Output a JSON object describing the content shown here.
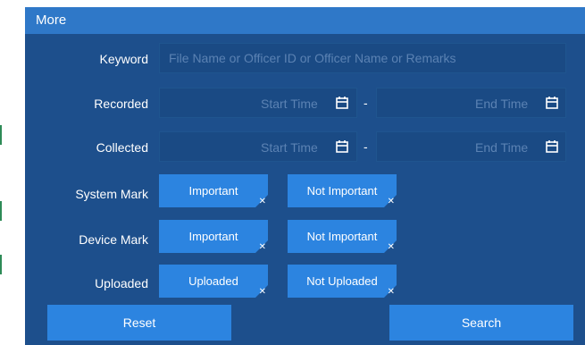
{
  "dialog": {
    "title": "More"
  },
  "keyword": {
    "label": "Keyword",
    "placeholder": "File Name or Officer ID or Officer Name or Remarks"
  },
  "recorded": {
    "label": "Recorded",
    "start_placeholder": "Start Time",
    "end_placeholder": "End Time",
    "separator": "-"
  },
  "collected": {
    "label": "Collected",
    "start_placeholder": "Start Time",
    "end_placeholder": "End Time",
    "separator": "-"
  },
  "system_mark": {
    "label": "System Mark",
    "options": [
      "Important",
      "Not Important"
    ]
  },
  "device_mark": {
    "label": "Device Mark",
    "options": [
      "Important",
      "Not Important"
    ]
  },
  "uploaded": {
    "label": "Uploaded",
    "options": [
      "Uploaded",
      "Not Uploaded"
    ]
  },
  "actions": {
    "reset_label": "Reset",
    "search_label": "Search"
  },
  "icons": {
    "calendar": "calendar-icon",
    "remove": "close-icon"
  },
  "colors": {
    "panel": "#1d4f8c",
    "header": "#2f78c8",
    "accent": "#2c84e0"
  }
}
